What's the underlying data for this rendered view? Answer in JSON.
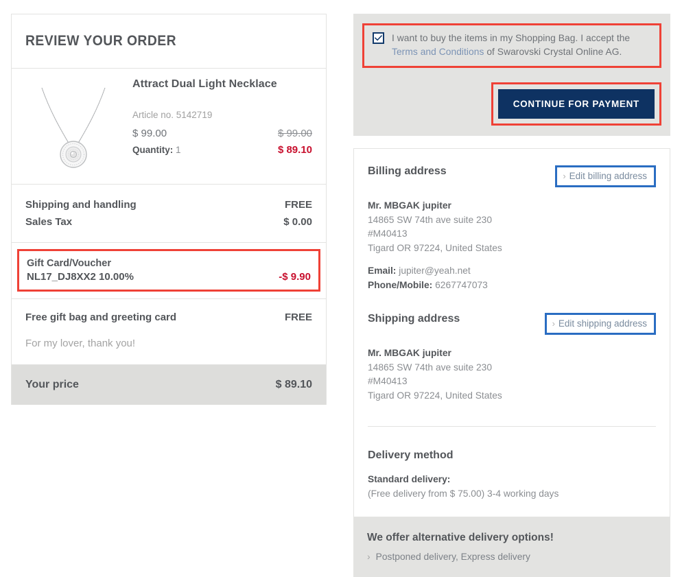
{
  "order_panel": {
    "title": "REVIEW YOUR ORDER",
    "product": {
      "name": "Attract Dual Light Necklace",
      "article_no": "Article no. 5142719",
      "unit_price": "$ 99.00",
      "old_price": "$ 99.00",
      "quantity_label": "Quantity:",
      "quantity_value": "1",
      "discounted_price": "$ 89.10",
      "image_alt": "necklace-thumbnail"
    },
    "shipping_row": {
      "label": "Shipping and handling",
      "value": "FREE"
    },
    "tax_row": {
      "label": "Sales Tax",
      "value": "$ 0.00"
    },
    "gift_card": {
      "title": "Gift Card/Voucher",
      "code": "NL17_DJ8XX2 10.00%",
      "amount": "-$ 9.90"
    },
    "gift_bag": {
      "label": "Free gift bag and greeting card",
      "value": "FREE",
      "message": "For my lover, thank you!"
    },
    "total": {
      "label": "Your price",
      "value": "$ 89.10"
    }
  },
  "terms_panel": {
    "checkbox_checked": true,
    "text_before": "I want to buy the items in my Shopping Bag. I accept the ",
    "link_text": "Terms and Conditions",
    "text_after": " of Swarovski Crystal Online AG.",
    "cta_label": "CONTINUE FOR PAYMENT"
  },
  "billing": {
    "title": "Billing address",
    "edit_label": "Edit billing address",
    "name": "Mr. MBGAK jupiter",
    "line1": "14865 SW 74th ave suite 230",
    "line2": "#M40413",
    "line3": "Tigard OR 97224, United States",
    "email_label": "Email:",
    "email_value": "jupiter@yeah.net",
    "phone_label": "Phone/Mobile:",
    "phone_value": "6267747073"
  },
  "shipping": {
    "title": "Shipping address",
    "edit_label": "Edit shipping address",
    "name": "Mr. MBGAK jupiter",
    "line1": "14865 SW 74th ave suite 230",
    "line2": "#M40413",
    "line3": "Tigard OR 97224, United States"
  },
  "delivery": {
    "title": "Delivery method",
    "standard_label": "Standard delivery:",
    "standard_desc": "(Free delivery from $ 75.00) 3-4 working days"
  },
  "alternative": {
    "title": "We offer alternative delivery options!",
    "link": "Postponed delivery, Express delivery"
  },
  "colors": {
    "accent_navy": "#0e3262",
    "highlight_red": "#ef4136",
    "highlight_blue": "#2a6dc2",
    "price_red": "#c8102e",
    "panel_gray": "#e3e3e1",
    "total_gray": "#dddddb",
    "text_dark": "#53565a",
    "text_muted": "#8b8e92"
  }
}
